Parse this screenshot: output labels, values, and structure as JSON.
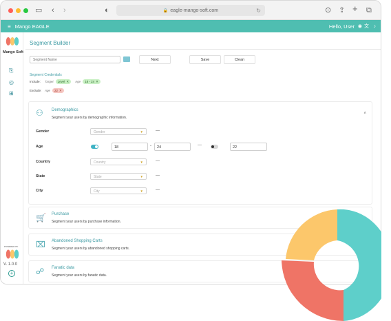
{
  "browser": {
    "url": "eagle-mango-soft.com"
  },
  "appbar": {
    "menu_icon": "hamburger-icon",
    "title": "Mango EAGLE",
    "greeting": "Hello, User"
  },
  "sidebar": {
    "logo_text": "Mango Soft",
    "powered_by": "POWERED BY",
    "version": "V. 1.0.0"
  },
  "page": {
    "title": "Segment Builder"
  },
  "toolbar": {
    "segment_name_placeholder": "Segment Name",
    "next_label": "Next",
    "save_label": "Save",
    "clean_label": "Clean"
  },
  "criteria": {
    "title": "Segment Credentials",
    "include_label": "Include:",
    "exclude_label": "Exclude:",
    "include": [
      {
        "key": "Target",
        "value": "Level"
      },
      {
        "key": "Age",
        "value": "18 - 24"
      }
    ],
    "exclude": [
      {
        "key": "Age",
        "value": "22"
      }
    ]
  },
  "demographics": {
    "title": "Demographics",
    "subtitle": "Segment your users by demographic information.",
    "fields": {
      "gender": {
        "label": "Gender",
        "placeholder": "Gender",
        "dash": "—"
      },
      "age": {
        "label": "Age",
        "min": "18",
        "separator": "-",
        "max": "24",
        "dash": "—",
        "exclude_value": "22"
      },
      "country": {
        "label": "Country",
        "placeholder": "Country",
        "dash": "—"
      },
      "state": {
        "label": "State",
        "placeholder": "State",
        "dash": "—"
      },
      "city": {
        "label": "City",
        "placeholder": "City",
        "dash": "—"
      }
    }
  },
  "sections": [
    {
      "title": "Purchase",
      "subtitle": "Segment your users by purchase information."
    },
    {
      "title": "Abandoned Shopping Carts",
      "subtitle": "Segment your users by abandoned shopping carts."
    },
    {
      "title": "Fanatic data",
      "subtitle": "Segment your users by fanatic data."
    }
  ],
  "colors": {
    "accent": "#4fbeb1",
    "donut_teal": "#5ecfca",
    "donut_yellow": "#fcc76b",
    "donut_red": "#ef7466"
  }
}
